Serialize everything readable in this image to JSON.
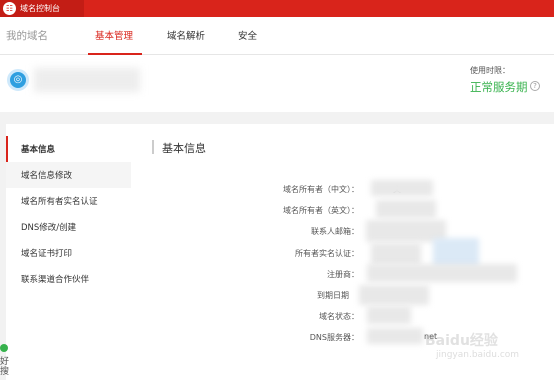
{
  "header": {
    "logo_glyph": "☷",
    "title": "域名控制台"
  },
  "nav": {
    "home": "我的域名",
    "tabs": [
      {
        "label": "基本管理",
        "active": true
      },
      {
        "label": "域名解析",
        "active": false
      },
      {
        "label": "安全",
        "active": false
      }
    ]
  },
  "domain_info": {
    "icon_glyph": "◎",
    "status_label": "使用时限：",
    "status_value": "正常服务期",
    "help_glyph": "?"
  },
  "sidebar": {
    "items": [
      {
        "label": "基本信息",
        "active": true
      },
      {
        "label": "域名信息修改",
        "active": false
      },
      {
        "label": "域名所有者实名认证",
        "active": false
      },
      {
        "label": "DNS修改/创建",
        "active": false
      },
      {
        "label": "域名证书打印",
        "active": false
      },
      {
        "label": "联系渠道合作伙伴",
        "active": false
      }
    ]
  },
  "main": {
    "section_title": "基本信息",
    "rows": [
      {
        "label": "域名所有者（中文）：",
        "value": "文"
      },
      {
        "label": "域名所有者（英文）：",
        "value": ""
      },
      {
        "label": "联系人邮箱：",
        "value": ""
      },
      {
        "label": "所有者实名认证：",
        "value": ""
      },
      {
        "label": "注册商：",
        "value": ""
      },
      {
        "label": "到期日期",
        "value": ""
      },
      {
        "label": "域名状态：",
        "value": ""
      },
      {
        "label": "DNS服务器：",
        "value": "net"
      }
    ]
  },
  "float_widget": {
    "text": "好搜"
  },
  "watermark": {
    "main": "Baidu经验",
    "sub": "jingyan.baidu.com"
  },
  "colors": {
    "brand_red": "#d9241b",
    "status_green": "#37b24d",
    "icon_blue": "#2f9fe0"
  }
}
